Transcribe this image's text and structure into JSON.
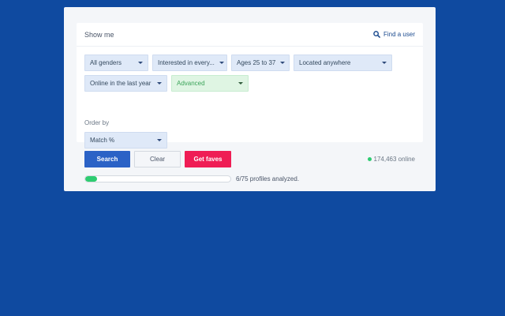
{
  "header": {
    "title": "Show me",
    "find_user": "Find a user"
  },
  "filters": {
    "gender": "All genders",
    "interested": "Interested in every...",
    "ages": "Ages 25 to 37",
    "location": "Located anywhere",
    "online": "Online in the last year",
    "advanced": "Advanced"
  },
  "order": {
    "label": "Order by",
    "value": "Match %"
  },
  "buttons": {
    "search": "Search",
    "clear": "Clear",
    "faves": "Get faves"
  },
  "status": {
    "online_text": "174,463 online"
  },
  "progress": {
    "analyzed": 6,
    "total": 75,
    "text": "6/75 profiles analyzed."
  },
  "colors": {
    "background": "#0f4aa0",
    "search": "#2b62c6",
    "faves": "#ef1d55",
    "online": "#2ecc71",
    "advanced": "#3da55b"
  }
}
